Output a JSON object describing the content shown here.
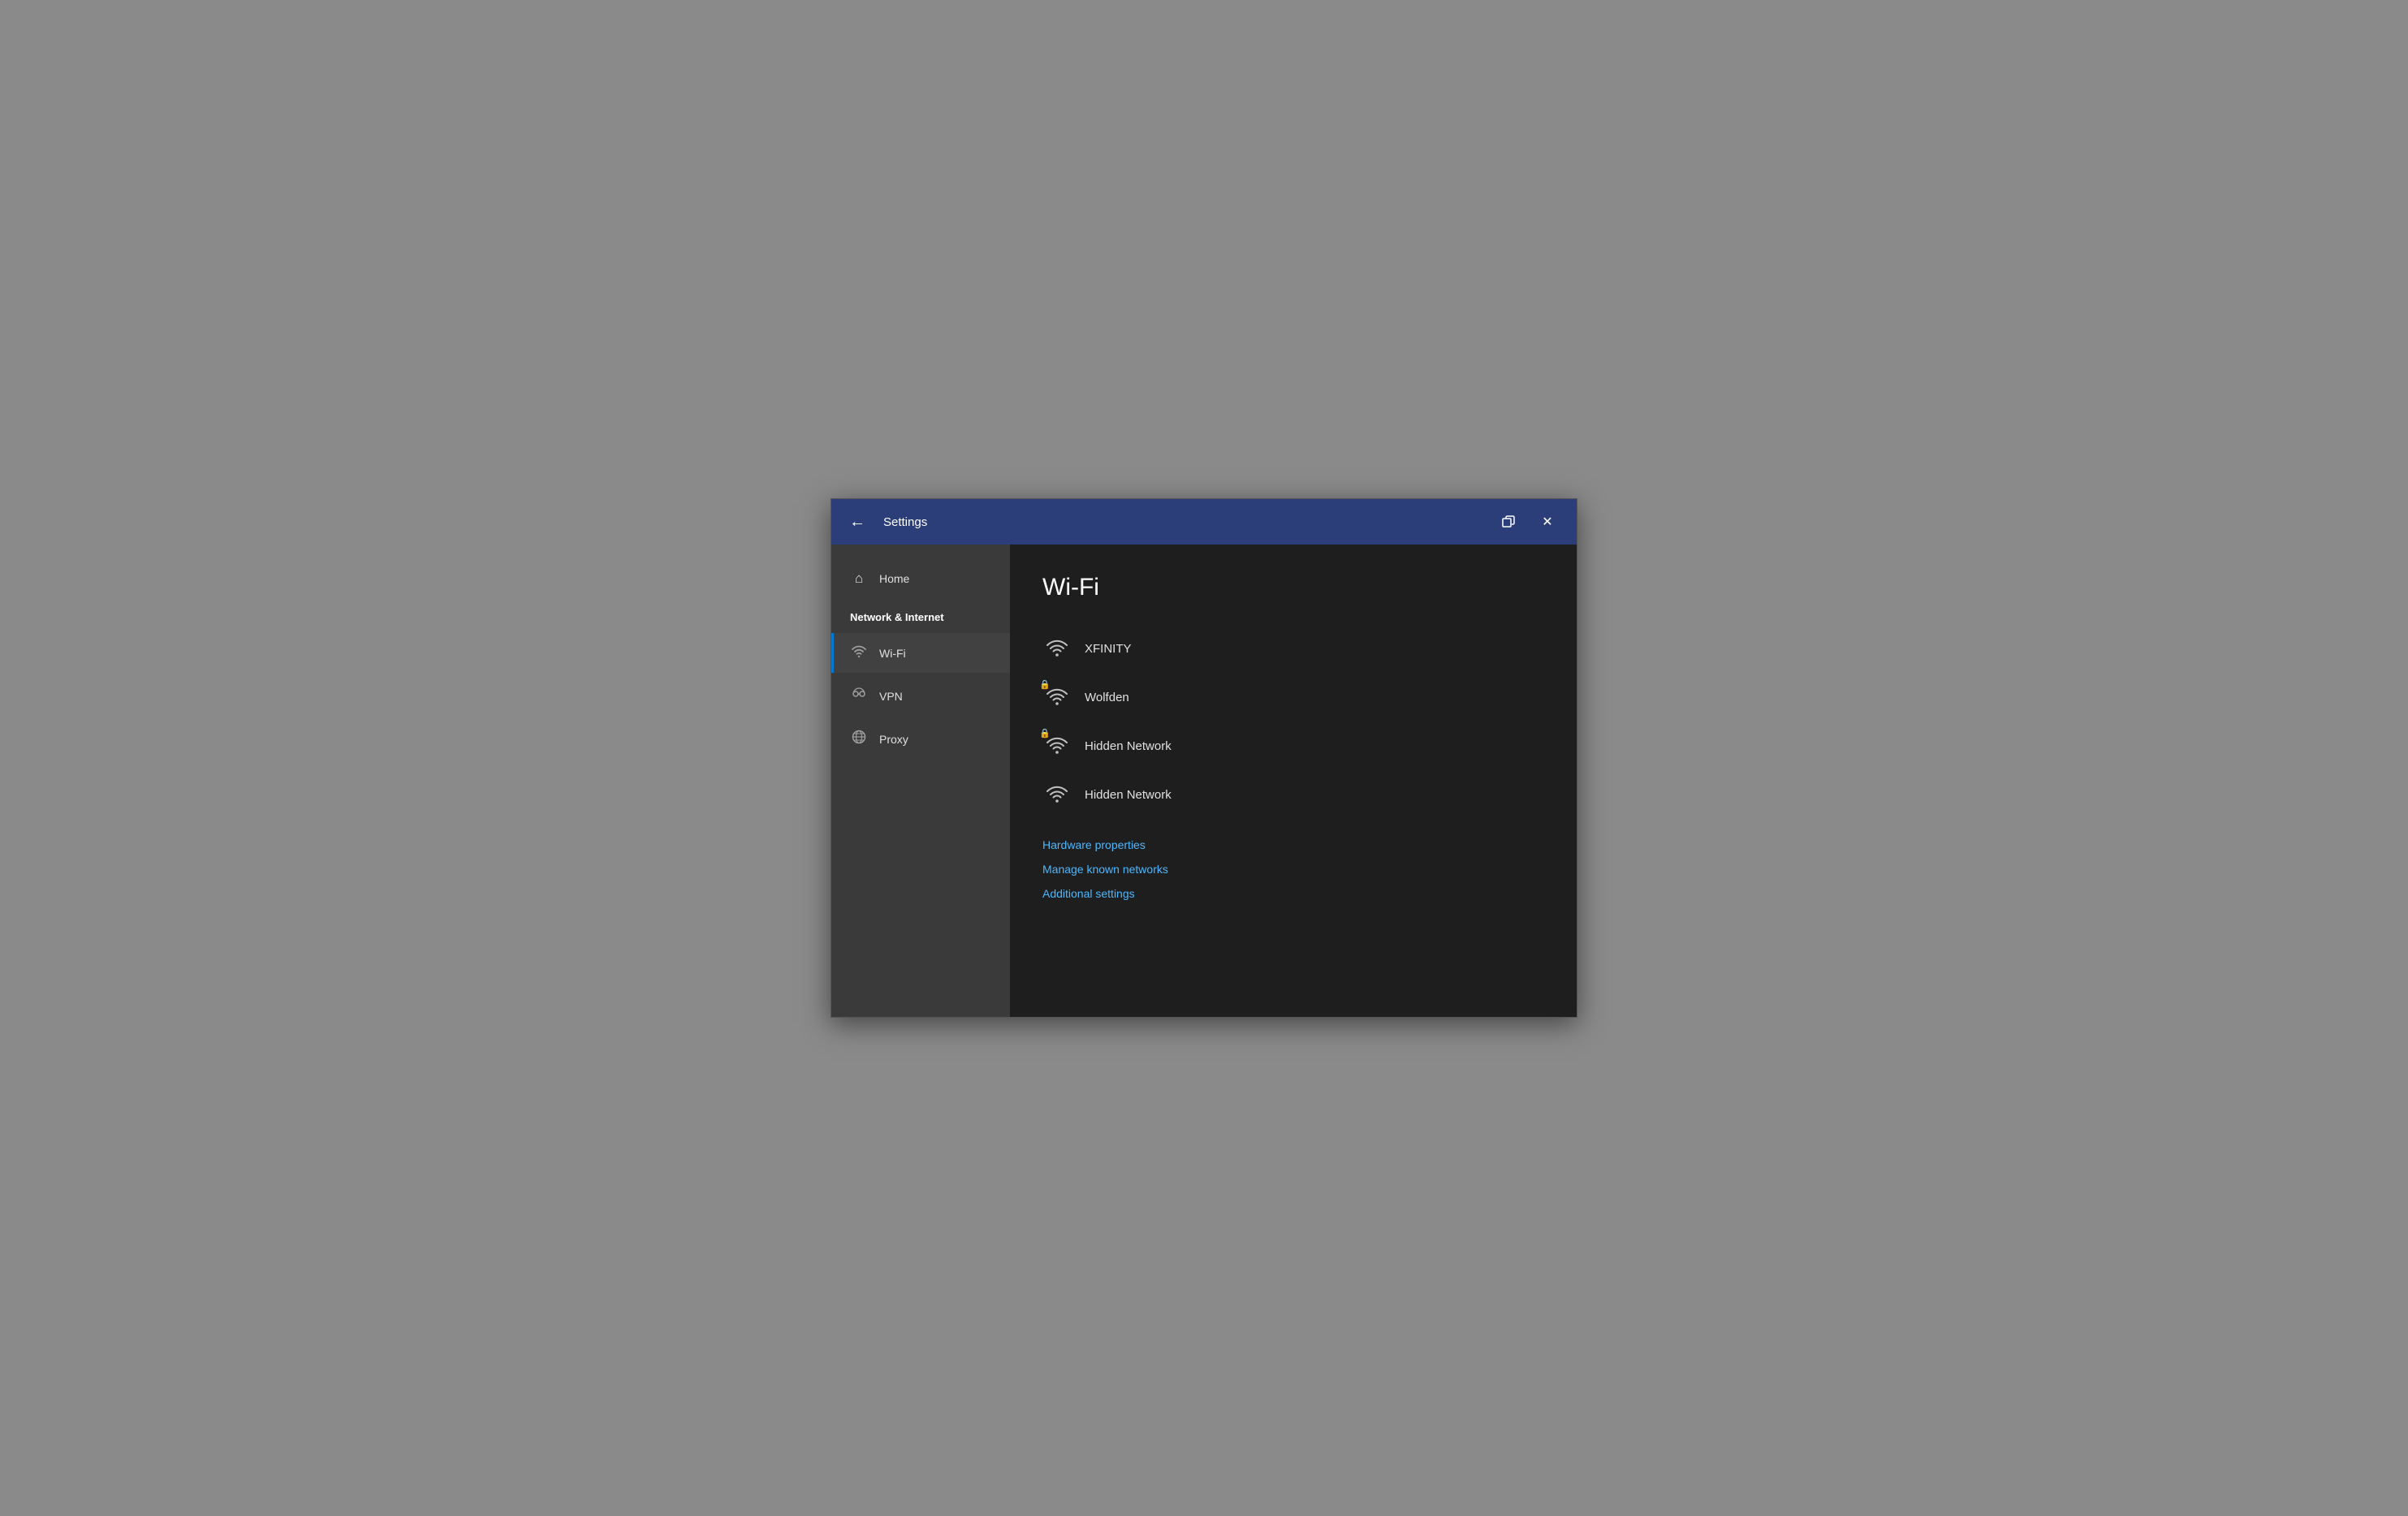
{
  "titlebar": {
    "title": "Settings",
    "back_label": "←",
    "restore_label": "❐",
    "close_label": "✕"
  },
  "sidebar": {
    "home_label": "Home",
    "section_label": "Network & Internet",
    "items": [
      {
        "id": "wifi",
        "label": "Wi-Fi",
        "icon": "wifi",
        "active": true
      },
      {
        "id": "vpn",
        "label": "VPN",
        "icon": "vpn",
        "active": false
      },
      {
        "id": "proxy",
        "label": "Proxy",
        "icon": "globe",
        "active": false
      }
    ]
  },
  "main": {
    "title": "Wi-Fi",
    "networks": [
      {
        "name": "XFINITY",
        "secured": false
      },
      {
        "name": "Wolfden",
        "secured": true
      },
      {
        "name": "Hidden Network",
        "secured": true
      },
      {
        "name": "Hidden Network",
        "secured": false
      }
    ],
    "links": [
      {
        "id": "hardware-properties",
        "label": "Hardware properties"
      },
      {
        "id": "manage-known-networks",
        "label": "Manage known networks"
      },
      {
        "id": "additional-settings",
        "label": "Additional settings"
      }
    ]
  }
}
